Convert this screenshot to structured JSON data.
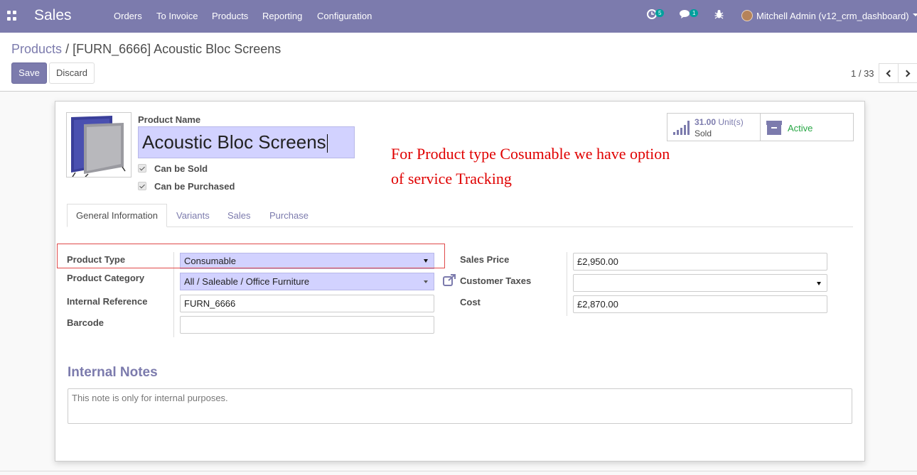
{
  "navbar": {
    "brand": "Sales",
    "menu": [
      "Orders",
      "To Invoice",
      "Products",
      "Reporting",
      "Configuration"
    ],
    "activity_count": "5",
    "message_count": "1",
    "user": "Mitchell Admin (v12_crm_dashboard)"
  },
  "breadcrumb": {
    "parent": "Products",
    "separator": "/",
    "current": "[FURN_6666] Acoustic Bloc Screens"
  },
  "buttons": {
    "save": "Save",
    "discard": "Discard"
  },
  "pager": {
    "value": "1 / 33"
  },
  "stat_buttons": {
    "sold_value": "31.00",
    "sold_unit": "Unit(s)",
    "sold_label": "Sold",
    "active_label": "Active"
  },
  "product": {
    "name_label": "Product Name",
    "name": "Acoustic Bloc Screens",
    "can_be_sold": "Can be Sold",
    "can_be_purchased": "Can be Purchased"
  },
  "annotation": {
    "line1": "For Product type Cosumable we have option",
    "line2": "of service Tracking"
  },
  "tabs": [
    "General Information",
    "Variants",
    "Sales",
    "Purchase"
  ],
  "general": {
    "product_type_label": "Product Type",
    "product_type": "Consumable",
    "product_category_label": "Product Category",
    "product_category": "All / Saleable / Office Furniture",
    "internal_reference_label": "Internal Reference",
    "internal_reference": "FURN_6666",
    "barcode_label": "Barcode",
    "barcode": "",
    "sales_price_label": "Sales Price",
    "sales_price": "£2,950.00",
    "customer_taxes_label": "Customer Taxes",
    "customer_taxes": "",
    "cost_label": "Cost",
    "cost": "£2,870.00"
  },
  "notes": {
    "title": "Internal Notes",
    "text": "This note is only for internal purposes."
  },
  "colors": {
    "brand": "#7c7bad",
    "highlight_input": "#d2d2ff",
    "annotation": "#e00000",
    "active": "#28a745"
  }
}
